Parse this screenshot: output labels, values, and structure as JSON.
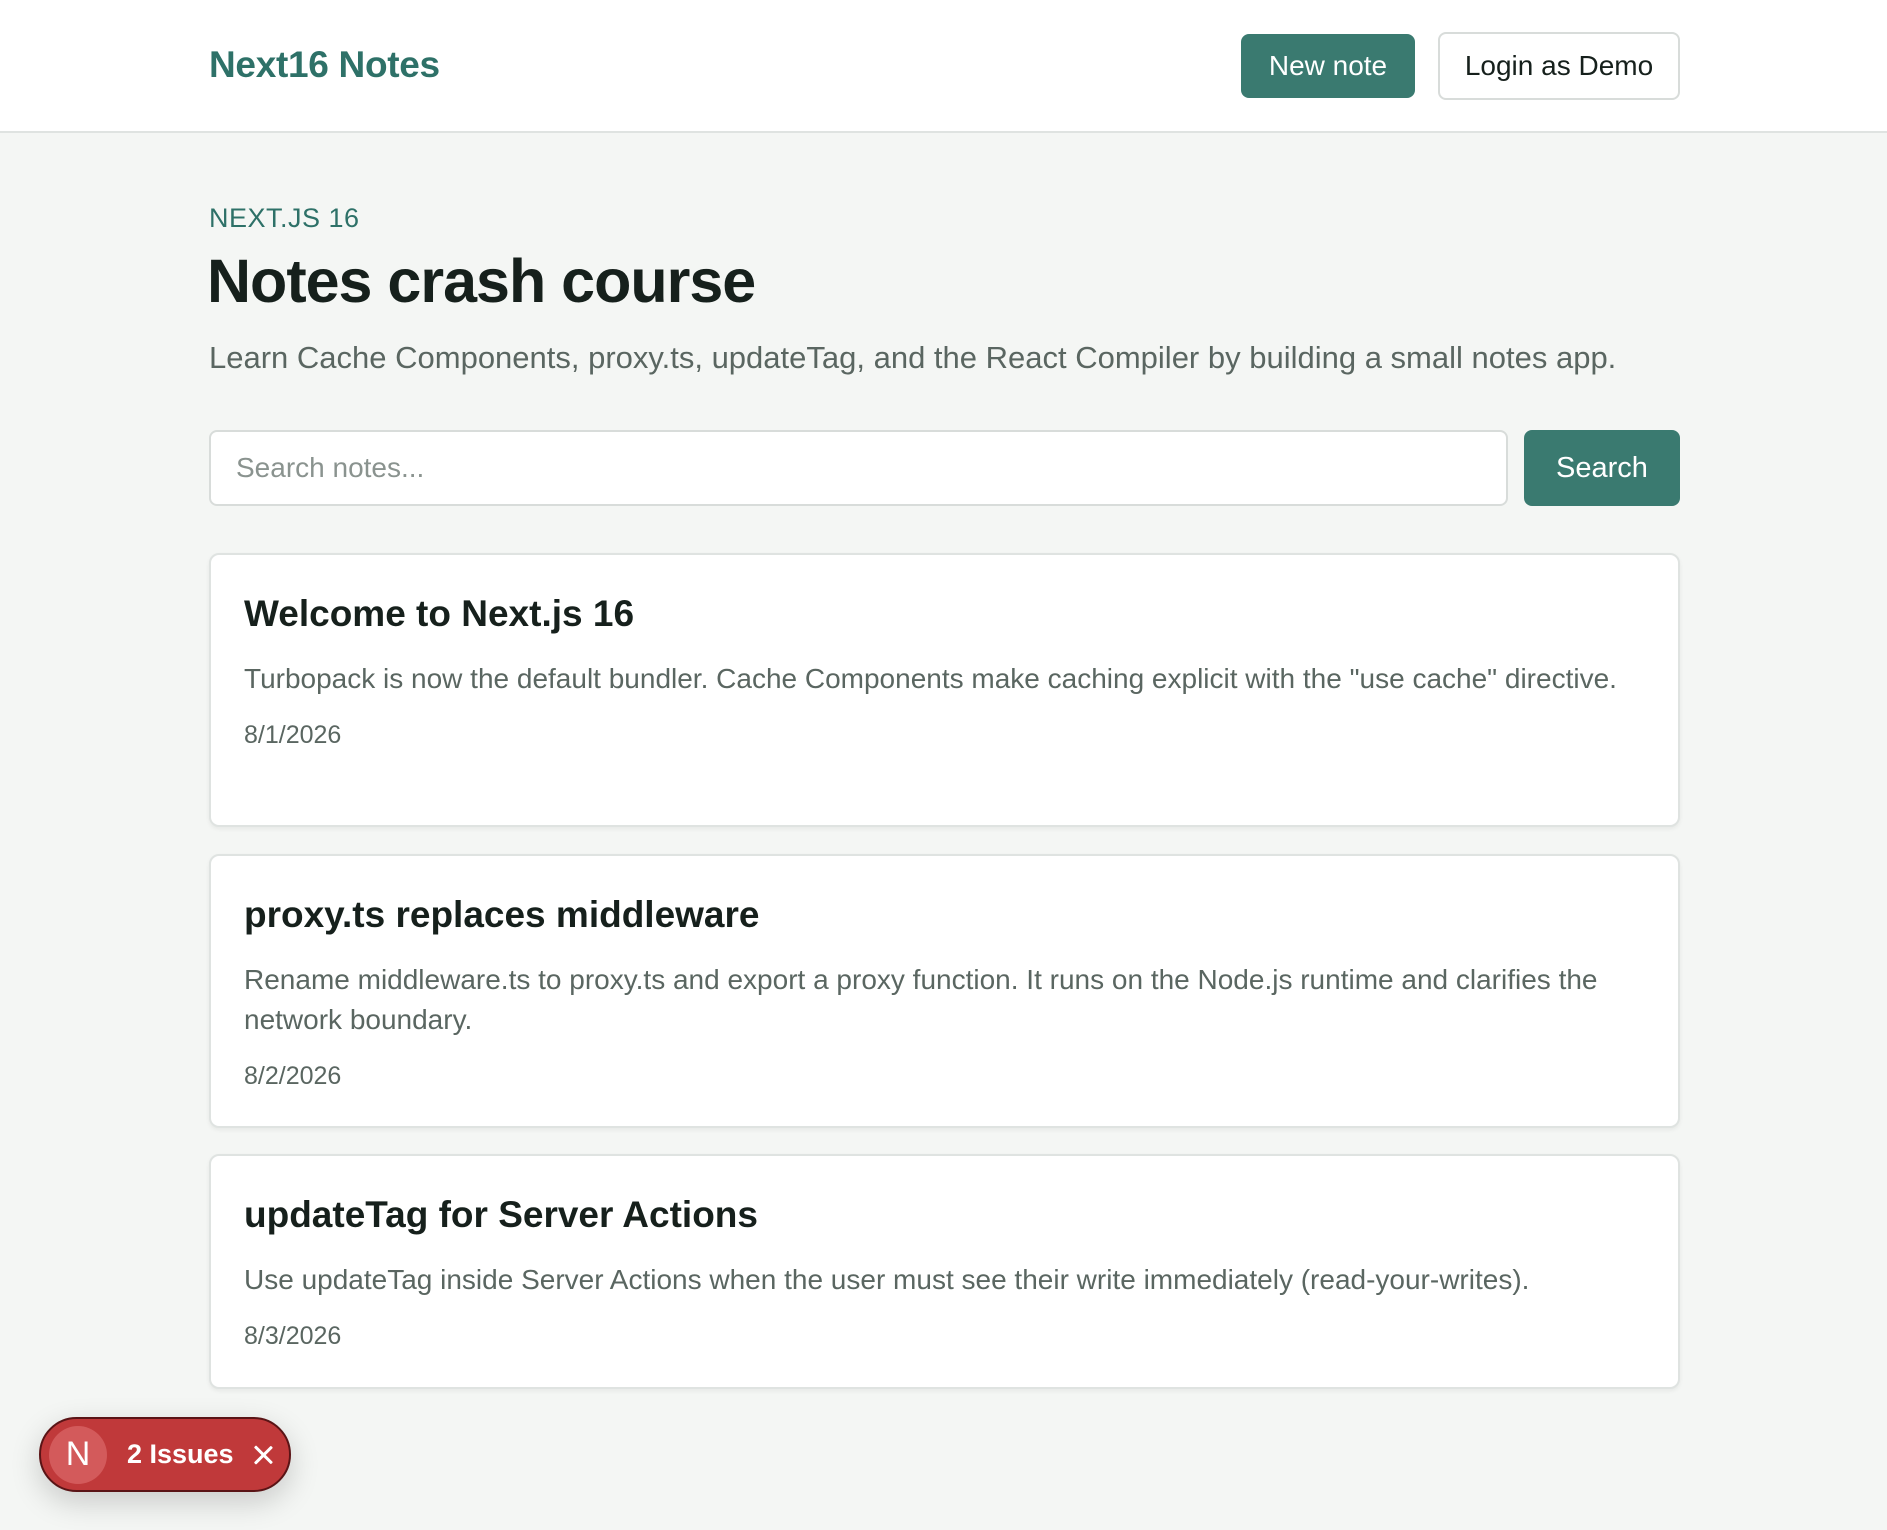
{
  "header": {
    "brand": "Next16 Notes",
    "new_note_label": "New note",
    "login_label": "Login as Demo"
  },
  "hero": {
    "eyebrow": "NEXT.JS 16",
    "title": "Notes crash course",
    "subtitle": "Learn Cache Components, proxy.ts, updateTag, and the React Compiler by building a small notes app."
  },
  "search": {
    "placeholder": "Search notes...",
    "value": "",
    "button_label": "Search"
  },
  "notes": [
    {
      "title": "Welcome to Next.js 16",
      "body": "Turbopack is now the default bundler. Cache Components make caching explicit with the \"use cache\" directive.",
      "date": "8/1/2026"
    },
    {
      "title": "proxy.ts replaces middleware",
      "body": "Rename middleware.ts to proxy.ts and export a proxy function. It runs on the Node.js runtime and clarifies the network boundary.",
      "date": "8/2/2026"
    },
    {
      "title": "updateTag for Server Actions",
      "body": "Use updateTag inside Server Actions when the user must see their write immediately (read-your-writes).",
      "date": "8/3/2026"
    }
  ],
  "dev_overlay": {
    "badge_letter": "N",
    "issues_label": "2 Issues",
    "color": "#c0393a"
  },
  "colors": {
    "accent": "#3a7a70",
    "brand_text": "#2e7168",
    "background": "#f4f6f4"
  }
}
